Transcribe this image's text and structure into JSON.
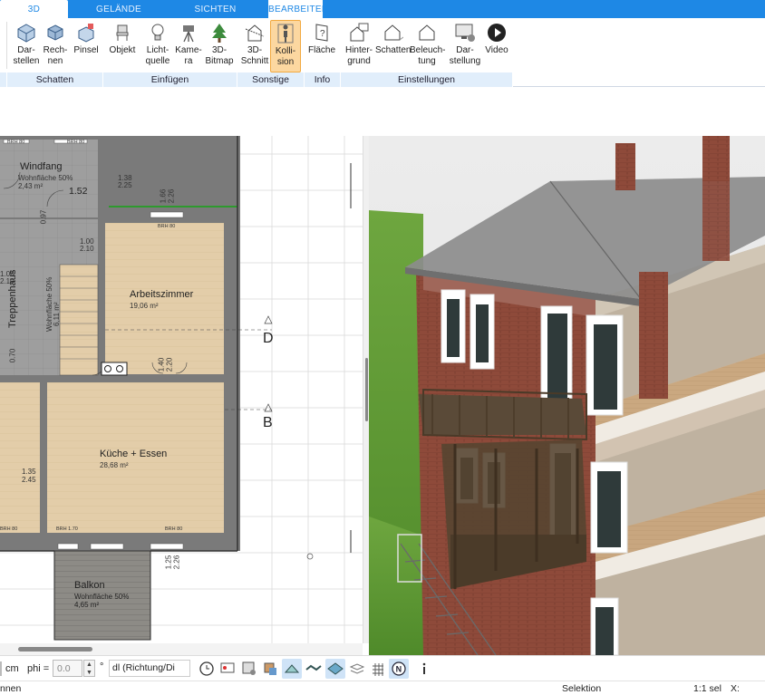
{
  "tabs": [
    {
      "label": "3D",
      "active": true
    },
    {
      "label": "GELÄNDE",
      "active": false
    },
    {
      "label": "SICHTEN",
      "active": false
    },
    {
      "label": "BEARBEITEN",
      "active": false
    }
  ],
  "ribbon": {
    "buttons": {
      "darstellen": "Dar-\nstellen",
      "rechnen": "Rech-\nnen",
      "pinsel": "Pinsel",
      "objekt": "Objekt",
      "lichtquelle": "Licht-\nquelle",
      "kamera": "Kame-\nra",
      "bitmap3d": "3D-\nBitmap",
      "schnitt3d": "3D-\nSchnitt",
      "kollision": "Kolli-\nsion",
      "flaeche": "Fläche",
      "hintergrund": "Hinter-\ngrund",
      "schatten": "Schatten",
      "beleuchtung": "Beleuch-\ntung",
      "darstellung": "Dar-\nstellung",
      "video": "Video"
    },
    "groups": {
      "schatten": "Schatten",
      "einfuegen": "Einfügen",
      "sonstige": "Sonstige",
      "info": "Info",
      "einstellungen": "Einstellungen"
    }
  },
  "plan": {
    "rooms": {
      "windfang_name": "Windfang",
      "windfang_sub": "Wohnfläche 50%",
      "windfang_area": "2,43 m²",
      "treppenhaus_name": "Treppenhaus",
      "treppenhaus_sub": "Wohnfläche 50%",
      "treppenhaus_area": "6,11 m²",
      "arbeitszimmer_name": "Arbeitszimmer",
      "arbeitszimmer_area": "19,06 m²",
      "kueche_name": "Küche + Essen",
      "kueche_area": "28,68 m²",
      "balkon_name": "Balkon",
      "balkon_sub": "Wohnfläche 50%",
      "balkon_area": "4,65 m²"
    },
    "dims": {
      "d152": "1.52",
      "d138": "1.38",
      "d225": "2.25",
      "d166": "1.66",
      "d226": "2.26",
      "d097": "0.97",
      "d210a": "1.00",
      "d210b": "2.10",
      "d100": "1.00",
      "d210c": "2.10",
      "d070": "0.70",
      "d140": "1.40",
      "d220": "2.20",
      "d135": "1.35",
      "d245": "2.45",
      "d125": "1.25",
      "d226b": "2.26",
      "brh80a": "BRH 80",
      "brh80b": "BRH 80",
      "brh80c": "BRH 80",
      "brh80d": "BRH 80",
      "brh170": "BRH 1.70",
      "brh80e": "BRH 80"
    },
    "section_d": "D",
    "section_b": "B"
  },
  "toolbar": {
    "unit": "cm",
    "phi_label": "phi =",
    "phi_value": "0.0",
    "degree": "°",
    "direction": "dl (Richtung/Di"
  },
  "status": {
    "left": "nnen",
    "mode": "Selektion",
    "scale": "1:1 sel",
    "x_label": "X:"
  },
  "colors": {
    "accent": "#1e88e5",
    "ribbon_group": "#e1eefb",
    "active_button": "#fcd7a0",
    "floor_wood": "#ddc6a4",
    "tile": "#9c9c9c"
  }
}
